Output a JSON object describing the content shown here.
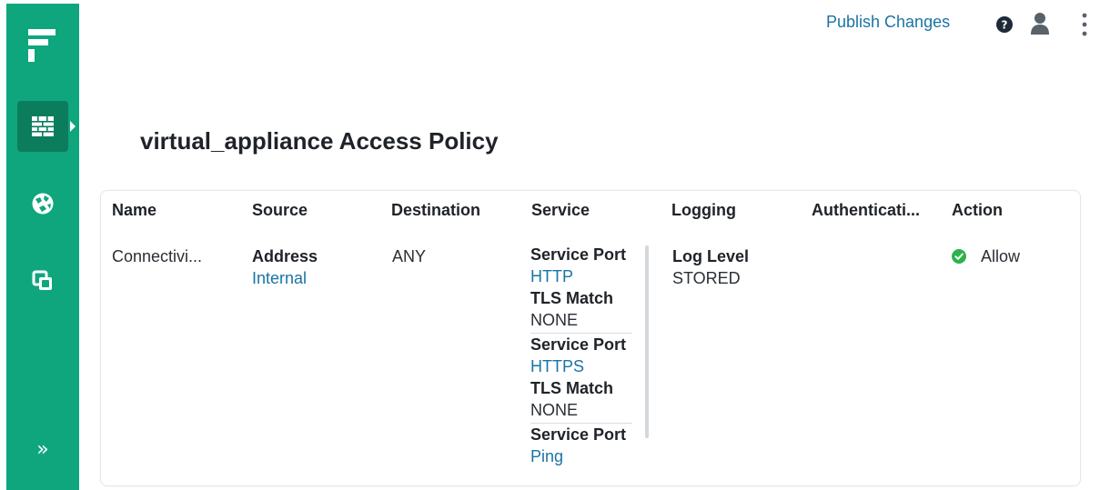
{
  "header": {
    "publish_label": "Publish Changes",
    "icons": [
      "help-icon",
      "user-icon",
      "more-vert-icon"
    ]
  },
  "sidebar": {
    "items": [
      {
        "icon": "firewall-icon",
        "active": true
      },
      {
        "icon": "globe-icon",
        "active": false
      },
      {
        "icon": "layers-icon",
        "active": false
      }
    ],
    "expand_label": "»"
  },
  "page": {
    "title": "virtual_appliance Access Policy"
  },
  "table": {
    "columns": [
      "Name",
      "Source",
      "Destination",
      "Service",
      "Logging",
      "Authenticati...",
      "Action"
    ],
    "row": {
      "name": "Connectivi...",
      "source_label": "Address",
      "source_value": "Internal",
      "destination": "ANY",
      "services": [
        {
          "port_label": "Service Port",
          "port": "HTTP",
          "tls_label": "TLS Match",
          "tls": "NONE"
        },
        {
          "port_label": "Service Port",
          "port": "HTTPS",
          "tls_label": "TLS Match",
          "tls": "NONE"
        },
        {
          "port_label": "Service Port",
          "port": "Ping"
        }
      ],
      "logging_label": "Log Level",
      "logging_value": "STORED",
      "action": "Allow"
    }
  },
  "colors": {
    "sidebar": "#0fa67e",
    "link": "#1a73a6",
    "allow": "#2bb24c"
  }
}
